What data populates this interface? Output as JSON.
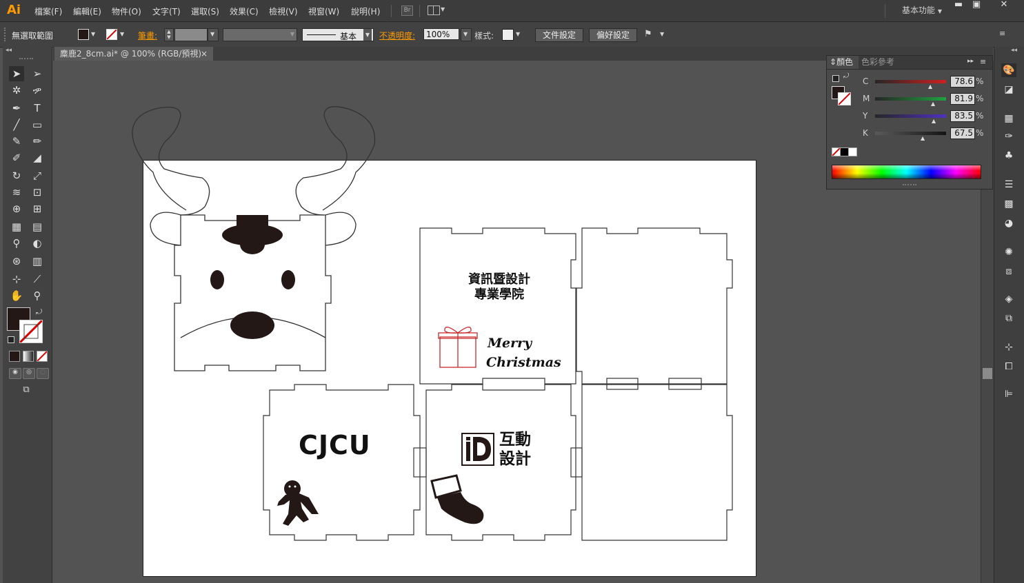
{
  "app": {
    "logo": "Ai"
  },
  "menu": [
    "檔案(F)",
    "編輯(E)",
    "物件(O)",
    "文字(T)",
    "選取(S)",
    "效果(C)",
    "檢視(V)",
    "視窗(W)",
    "說明(H)"
  ],
  "bridge_label": "Br",
  "workspace": "基本功能",
  "window_controls": {
    "minimize": "▬",
    "maximize": "▣",
    "close": "✕"
  },
  "control_bar": {
    "selection": "無選取範圍",
    "stroke_label": "筆畫:",
    "stroke_style": "基本",
    "opacity_label": "不透明度:",
    "opacity": "100%",
    "style_label": "樣式:",
    "doc_setup": "文件設定",
    "preferences": "偏好設定"
  },
  "document_tab": {
    "title": "麋鹿2_8cm.ai* @ 100% (RGB/預視)",
    "close": "×"
  },
  "color_panel": {
    "tab_active": "顏色",
    "tab_inactive": "色彩參考",
    "channels": [
      {
        "name": "C",
        "value": "78.6",
        "color": "#e02020",
        "pos": 0.786
      },
      {
        "name": "M",
        "value": "81.9",
        "color": "#20a040",
        "pos": 0.819
      },
      {
        "name": "Y",
        "value": "83.5",
        "color": "#5030c0",
        "pos": 0.835
      },
      {
        "name": "K",
        "value": "67.5",
        "color": "#888888",
        "pos": 0.675
      }
    ],
    "percent": "%",
    "fill_color": "#231815"
  },
  "artwork": {
    "school_title_line1": "資訊暨設計",
    "school_title_line2": "專業學院",
    "greeting_line1": "Merry",
    "greeting_line2": "Christmas",
    "brand": "CJCU",
    "dept_line1": "互動",
    "dept_line2": "設計",
    "logo_letter": "iD"
  },
  "colors": {
    "accent_orange": "#ff9a00",
    "gift_red": "#c8282b"
  }
}
